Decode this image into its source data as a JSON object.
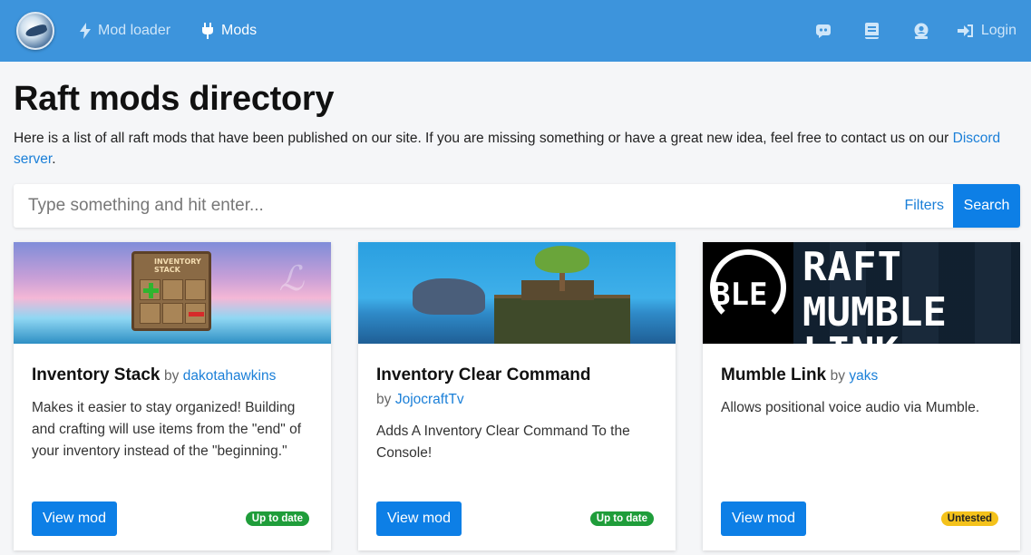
{
  "nav": {
    "items": [
      {
        "label": "Mod loader",
        "icon": "bolt-icon",
        "active": false
      },
      {
        "label": "Mods",
        "icon": "plug-icon",
        "active": true
      }
    ],
    "right_icons": [
      "discord-icon",
      "book-icon",
      "user-badge-icon"
    ],
    "login_label": "Login",
    "bg_color": "#3d94dc"
  },
  "page": {
    "title": "Raft mods directory",
    "intro_text": "Here is a list of all raft mods that have been published on our site. If you are missing something or have a great new idea, feel free to contact us on our ",
    "intro_link": "Discord server",
    "intro_end": "."
  },
  "search": {
    "placeholder": "Type something and hit enter...",
    "filters_label": "Filters",
    "button_label": "Search"
  },
  "cards": [
    {
      "title": "Inventory Stack",
      "by": "by",
      "author": "dakotahawkins",
      "description": "Makes it easier to stay organized! Building and crafting will use items from the \"end\" of your inventory instead of the \"beginning.\"",
      "button_label": "View mod",
      "status": "Up to date",
      "status_color": "#1f9d3a",
      "image_text": "INVENTORY STACK"
    },
    {
      "title": "Inventory Clear Command",
      "by": "by",
      "author": "JojocraftTv",
      "description": "Adds A Inventory Clear Command To the Console!",
      "button_label": "View mod",
      "status": "Up to date",
      "status_color": "#1f9d3a"
    },
    {
      "title": "Mumble Link",
      "by": "by",
      "author": "yaks",
      "description": "Allows positional voice audio via Mumble.",
      "button_label": "View mod",
      "status": "Untested",
      "status_color": "#f4c21b",
      "image_text_1": "RAFT",
      "image_text_2": "MUMBLE LINK",
      "image_text_3": "BLE"
    }
  ]
}
